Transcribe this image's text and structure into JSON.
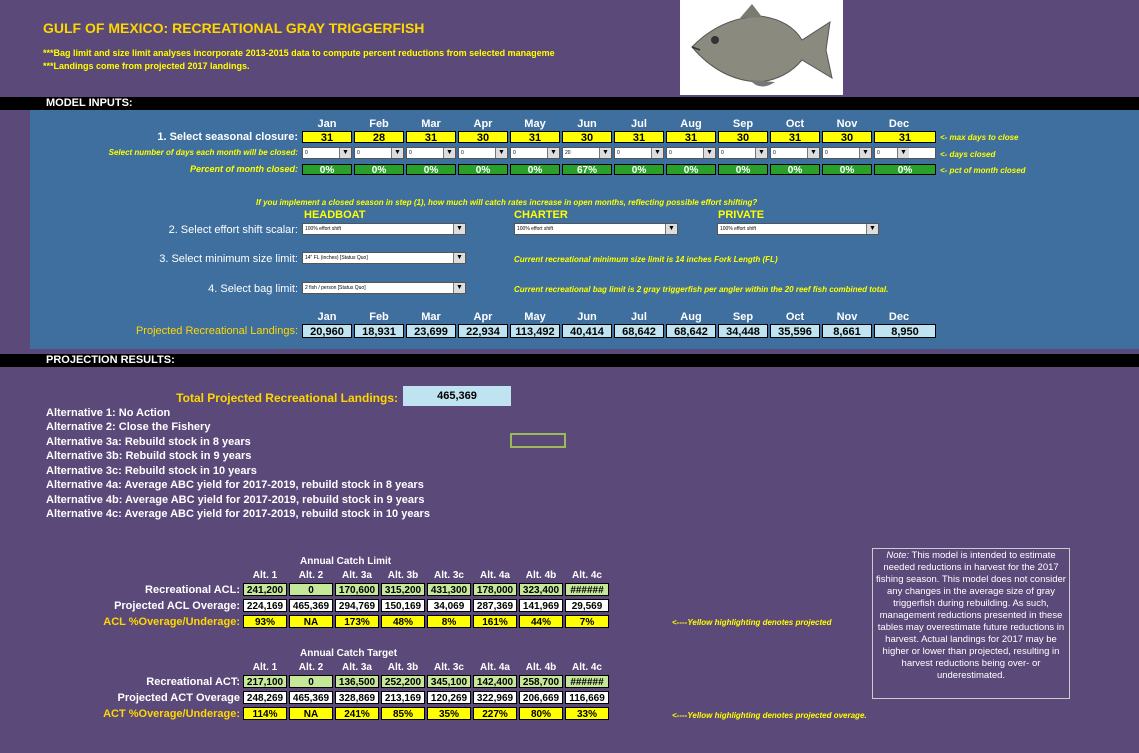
{
  "header": {
    "title": "GULF OF MEXICO: RECREATIONAL GRAY TRIGGERFISH",
    "note1": "***Bag limit and size limit analyses incorporate 2013-2015 data to compute percent reductions from selected manageme",
    "note2": "***Landings come from projected 2017 landings."
  },
  "sections": {
    "model_inputs": "MODEL INPUTS:",
    "projection_results": "PROJECTION RESULTS:"
  },
  "months": [
    "Jan",
    "Feb",
    "Mar",
    "Apr",
    "May",
    "Jun",
    "Jul",
    "Aug",
    "Sep",
    "Oct",
    "Nov",
    "Dec"
  ],
  "seasonal": {
    "label": "1. Select seasonal closure:",
    "max_days": [
      "31",
      "28",
      "31",
      "30",
      "31",
      "30",
      "31",
      "31",
      "30",
      "31",
      "30",
      "31"
    ],
    "days_label": "Select number of days each month will be closed:",
    "days_closed": [
      "0",
      "0",
      "0",
      "0",
      "0",
      "20",
      "0",
      "0",
      "0",
      "0",
      "0",
      "0"
    ],
    "pct_label": "Percent of month closed:",
    "pct_closed": [
      "0%",
      "0%",
      "0%",
      "0%",
      "0%",
      "67%",
      "0%",
      "0%",
      "0%",
      "0%",
      "0%",
      "0%"
    ],
    "note_max": "<- max days to close",
    "note_days": "<- days closed",
    "note_pct": "<- pct of month closed"
  },
  "effort": {
    "question": "If you implement a closed season in step (1), how much will catch rates increase in open months, reflecting possible effort shifting?",
    "headboat": "HEADBOAT",
    "charter": "CHARTER",
    "private": "PRIVATE",
    "label": "2. Select effort shift scalar:",
    "headboat_value": "100% effort shift",
    "charter_value": "100% effort shift",
    "private_value": "100% effort shift"
  },
  "size_limit": {
    "label": "3. Select minimum size limit:",
    "value": "14\" FL (inches) [Status Quo]",
    "note": "Current recreational minimum size limit is 14 inches Fork Length (FL)"
  },
  "bag_limit": {
    "label": "4. Select bag limit:",
    "value": "2 fish / person [Status Quo]",
    "note": "Current recreational bag limit is 2 gray triggerfish per angler within the 20 reef fish combined total."
  },
  "landings": {
    "label": "Projected Recreational Landings:",
    "values": [
      "20,960",
      "18,931",
      "23,699",
      "22,934",
      "113,492",
      "40,414",
      "68,642",
      "68,642",
      "34,448",
      "35,596",
      "8,661",
      "8,950"
    ]
  },
  "total": {
    "label": "Total Projected Recreational Landings:",
    "value": "465,369"
  },
  "alternatives": [
    "Alternative 1: No Action",
    "Alternative 2: Close the Fishery",
    "Alternative 3a: Rebuild stock in 8 years",
    "Alternative 3b: Rebuild stock in 9 years",
    "Alternative 3c: Rebuild stock in 10 years",
    "Alternative 4a: Average ABC yield for 2017-2019, rebuild stock in 8 years",
    "Alternative 4b: Average ABC yield for 2017-2019, rebuild stock in 9 years",
    "Alternative 4c: Average ABC yield for 2017-2019, rebuild stock in 10 years"
  ],
  "alt_headers": [
    "Alt. 1",
    "Alt. 2",
    "Alt. 3a",
    "Alt. 3b",
    "Alt. 3c",
    "Alt. 4a",
    "Alt. 4b",
    "Alt. 4c"
  ],
  "acl": {
    "title": "Annual Catch Limit",
    "row1_label": "Recreational ACL:",
    "row1": [
      "241,200",
      "0",
      "170,600",
      "315,200",
      "431,300",
      "178,000",
      "323,400",
      "######"
    ],
    "row2_label": "Projected ACL Overage:",
    "row2": [
      "224,169",
      "465,369",
      "294,769",
      "150,169",
      "34,069",
      "287,369",
      "141,969",
      "29,569"
    ],
    "row3_label": "ACL %Overage/Underage:",
    "row3": [
      "93%",
      "NA",
      "173%",
      "48%",
      "8%",
      "161%",
      "44%",
      "7%"
    ],
    "note": "<----Yellow highlighting denotes projected"
  },
  "act": {
    "title": "Annual Catch Target",
    "row1_label": "Recreational ACT:",
    "row1": [
      "217,100",
      "0",
      "136,500",
      "252,200",
      "345,100",
      "142,400",
      "258,700",
      "######"
    ],
    "row2_label": "Projected ACT Overage",
    "row2": [
      "248,269",
      "465,369",
      "328,869",
      "213,169",
      "120,269",
      "322,969",
      "206,669",
      "116,669"
    ],
    "row3_label": "ACT %Overage/Underage:",
    "row3": [
      "114%",
      "NA",
      "241%",
      "85%",
      "35%",
      "227%",
      "80%",
      "33%"
    ],
    "note": "<----Yellow highlighting denotes projected overage."
  },
  "model_note": {
    "label": "Note:",
    "text": "This model is intended to estimate needed reductions in harvest for the 2017 fishing season. This model does not consider any changes in the average size of gray triggerfish during rebuilding. As such, management reductions presented in these tables may overestimate future reductions in harvest. Actual landings for 2017 may be higher or lower than projected, resulting in harvest reductions being over- or underestimated."
  }
}
